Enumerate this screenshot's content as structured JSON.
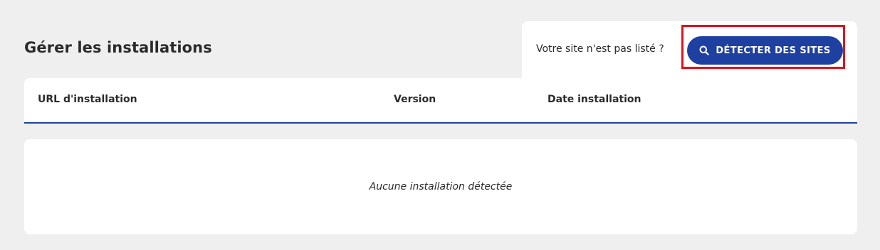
{
  "page": {
    "title": "Gérer les installations"
  },
  "detect": {
    "prompt": "Votre site n'est pas listé ?",
    "button_label": "DÉTECTER DES SITES",
    "button_icon": "search-icon"
  },
  "table": {
    "columns": [
      "URL d'installation",
      "Version",
      "Date installation"
    ],
    "empty_message": "Aucune installation détectée"
  },
  "colors": {
    "accent": "#1e40a0",
    "highlight": "#e0121a",
    "background": "#efefef",
    "surface": "#ffffff"
  }
}
